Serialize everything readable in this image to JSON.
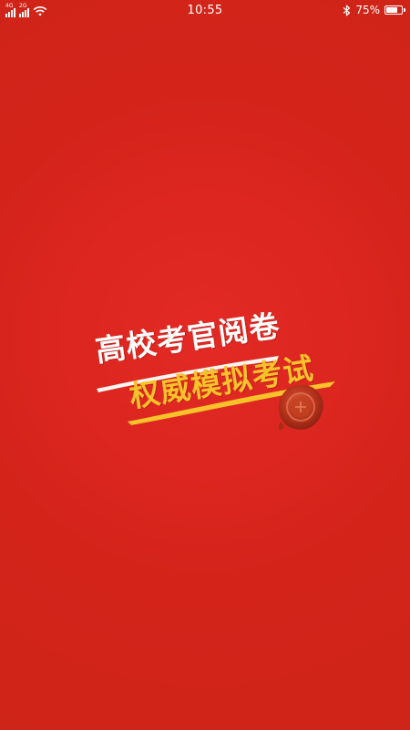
{
  "status_bar": {
    "network_1": "4G",
    "network_2": "2G",
    "time": "10:55",
    "battery_percent": "75%",
    "battery_level": 0.75,
    "icons": [
      "signal-icon",
      "wifi-icon",
      "bluetooth-icon",
      "battery-icon"
    ]
  },
  "splash": {
    "slogan_line1": "高校考官阅卷",
    "slogan_line2": "权威模拟考试",
    "colors": {
      "background": "#d4261a",
      "line1": "#ffffff",
      "line2": "#f7c22a",
      "seal": "#b8341c"
    }
  }
}
